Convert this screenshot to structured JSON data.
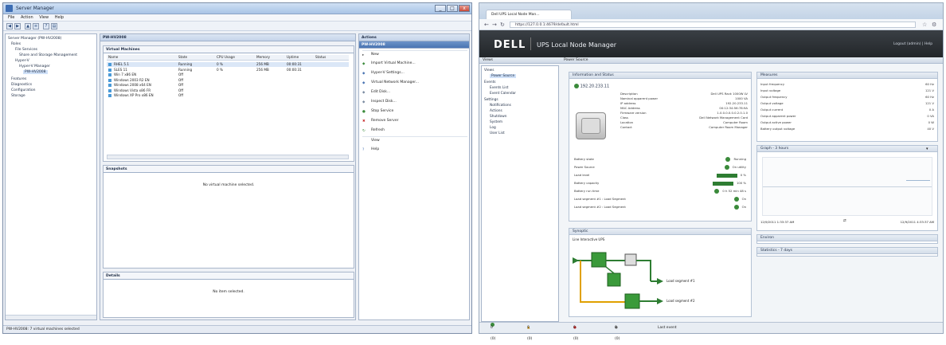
{
  "left_window": {
    "title": "Server Manager",
    "window_controls": [
      "_",
      "□",
      "x"
    ],
    "menu": [
      "File",
      "Action",
      "View",
      "Help"
    ],
    "tree": [
      "Server Manager (PW-HV2008)",
      "Roles",
      "File Services",
      "Share and Storage Management",
      "Hyper-V",
      "Hyper-V Manager",
      "PW-HV2008",
      "Features",
      "Diagnostics",
      "Configuration",
      "Storage"
    ],
    "middle_header": "PW-HV2008",
    "vm_section_title": "Virtual Machines",
    "vm_columns": [
      "Name",
      "State",
      "CPU Usage",
      "Memory",
      "Uptime",
      "Status"
    ],
    "vms": [
      {
        "name": "RHEL 5.1",
        "state": "Running",
        "cpu": "0 %",
        "memory": "256 MB",
        "uptime": "00:00:31"
      },
      {
        "name": "SLES 11",
        "state": "Running",
        "cpu": "0 %",
        "memory": "256 MB",
        "uptime": "00:00:31"
      },
      {
        "name": "Win 7 x86 EN",
        "state": "Off",
        "cpu": "",
        "memory": "",
        "uptime": ""
      },
      {
        "name": "Windows 2003 R2 EN",
        "state": "Off",
        "cpu": "",
        "memory": "",
        "uptime": ""
      },
      {
        "name": "Windows 2008 x64 EN",
        "state": "Off",
        "cpu": "",
        "memory": "",
        "uptime": ""
      },
      {
        "name": "Windows Vista x86 FR",
        "state": "Off",
        "cpu": "",
        "memory": "",
        "uptime": ""
      },
      {
        "name": "Windows XP Pro x86 EN",
        "state": "Off",
        "cpu": "",
        "memory": "",
        "uptime": ""
      }
    ],
    "snapshots_title": "Snapshots",
    "snapshots_empty": "No virtual machine selected.",
    "details_title": "Details",
    "details_empty": "No item selected.",
    "actions_title": "Actions",
    "actions_sub": "PW-HV2008",
    "actions": [
      "New",
      "Import Virtual Machine...",
      "Hyper-V Settings...",
      "Virtual Network Manager...",
      "Edit Disk...",
      "Inspect Disk...",
      "Stop Service",
      "Remove Server",
      "Refresh",
      "View",
      "Help"
    ],
    "status": "PW-HV2008: 7 virtual machines selected"
  },
  "right_window": {
    "tab_title": "Dell UPS Local Node Man...",
    "url": "https://127.0.0.1:4679/default.html",
    "logo": "DELL",
    "app_title": "UPS Local Node Manager",
    "logout": "Logout (admin) | Help",
    "nav_header": "Views",
    "content_header": "Power Source",
    "tree": [
      "Views",
      "Power Source",
      "Events",
      "Events List",
      "Event Calendar",
      "Settings",
      "Notifications",
      "Actions",
      "Shutdown",
      "System",
      "Log",
      "User List"
    ],
    "info_title": "Information and Status",
    "device_name": "192.20.233.11",
    "info": [
      [
        "Description",
        "Dell UPS Rack 1000W LV"
      ],
      [
        "Nominal apparent power",
        "1000 VA"
      ],
      [
        "IP address",
        "192.20.233.11"
      ],
      [
        "MAC Address",
        "00:12:34:56:78:9A"
      ],
      [
        "Firmware version",
        "1.0.0.0.0.0.0.2.0.1.0"
      ],
      [
        "Class",
        "Dell Network Management Card"
      ],
      [
        "Location",
        "Computer Room"
      ],
      [
        "Contact",
        "Computer Room Manager"
      ]
    ],
    "states": [
      [
        "Battery state",
        "Running"
      ],
      [
        "Power Source",
        "On utility"
      ],
      [
        "Load level",
        "0 %"
      ],
      [
        "Battery capacity",
        "100 %"
      ],
      [
        "Battery run time",
        "0 h 52 min 48 s"
      ],
      [
        "Load segment #1 : Load Segment",
        "On"
      ],
      [
        "Load segment #2 : Load Segment",
        "On"
      ]
    ],
    "synoptic_title": "Synoptic",
    "synoptic_sub": "Line Interactive UPS",
    "load_segments": [
      "Load segment #1",
      "Load segment #2"
    ],
    "measures_title": "Measures",
    "measures": [
      [
        "Input frequency",
        "60 Hz"
      ],
      [
        "Input voltage",
        "121 V"
      ],
      [
        "Output frequency",
        "60 Hz"
      ],
      [
        "Output voltage",
        "121 V"
      ],
      [
        "Output current",
        "0 A"
      ],
      [
        "Output apparent power",
        "0 VA"
      ],
      [
        "Output active power",
        "0 W"
      ],
      [
        "Battery output voltage",
        "40 V"
      ]
    ],
    "graph_title": "Graph - 3 hours",
    "graph_from": "12/9/2011 1:33:37 AM",
    "graph_to": "12/9/2011 4:33:37 AM",
    "environ_title": "Environ",
    "stats_title": "Statistics - 7 days",
    "statusbar": [
      "0 (0)",
      "0 (0)",
      "0 (0)",
      "0 (0)",
      "Last event"
    ],
    "colors": {
      "accent": "#2e7d32",
      "header_dark": "#2a2e33"
    }
  }
}
